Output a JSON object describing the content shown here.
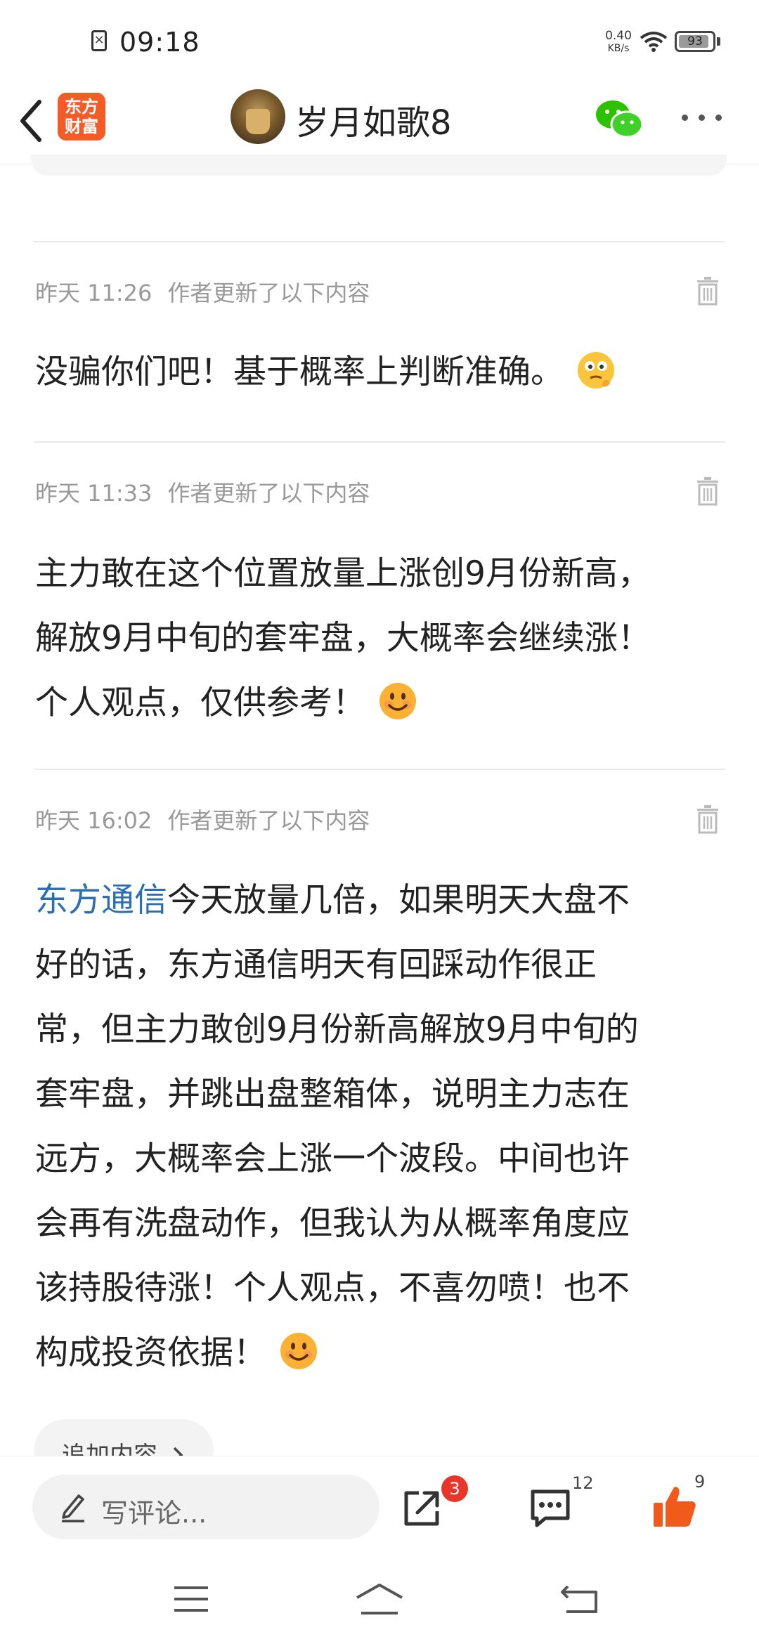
{
  "status_bar": {
    "time": "09:18",
    "net_speed_value": "0.40",
    "net_speed_unit": "KB/s",
    "battery": "93",
    "battery_level_percent": 93
  },
  "header": {
    "logo_line1": "东方",
    "logo_line2": "财富",
    "username": "岁月如歌8",
    "icons": [
      "back-icon",
      "wechat-icon",
      "more-icon"
    ]
  },
  "updates": [
    {
      "time": "昨天 11:26",
      "note": "作者更新了以下内容",
      "text": "没骗你们吧！基于概率上判断准确。",
      "emoji": "thinking-face"
    },
    {
      "time": "昨天 11:33",
      "note": "作者更新了以下内容",
      "lines": [
        "主力敢在这个位置放量上涨创9月份新高，",
        "解放9月中旬的套牢盘，大概率会继续涨！",
        "个人观点，仅供参考！"
      ],
      "emoji": "smiling-face"
    },
    {
      "time": "昨天 16:02",
      "note": "作者更新了以下内容",
      "link": "东方通信",
      "lines": [
        "今天放量几倍，如果明天大盘不",
        "好的话，东方通信明天有回踩动作很正",
        "常，但主力敢创9月份新高解放9月中旬的",
        "套牢盘，并跳出盘整箱体，说明主力志在",
        "远方，大概率会上涨一个波段。中间也许",
        "会再有洗盘动作，但我认为从概率角度应",
        "该持股待涨！个人观点，不喜勿喷！也不",
        "构成投资依据！"
      ],
      "emoji": "smiling-face"
    }
  ],
  "add_content_label": "追加内容",
  "bottom_bar": {
    "comment_placeholder": "写评论...",
    "share_badge": "3",
    "comment_count": "12",
    "like_count": "9"
  },
  "colors": {
    "accent_orange": "#f35b27",
    "link_blue": "#2a6fb3",
    "badge_red": "#e9352a",
    "wechat_green": "#2dc100"
  }
}
